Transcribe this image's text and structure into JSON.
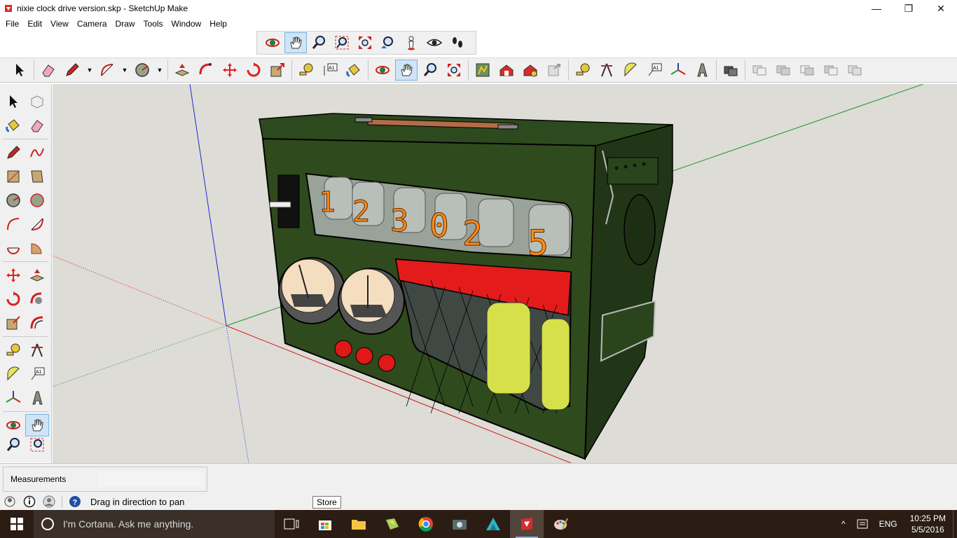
{
  "window": {
    "title": "nixie clock drive version.skp - SketchUp Make",
    "minimize": "—",
    "maximize": "❐",
    "close": "✕"
  },
  "menu": [
    "File",
    "Edit",
    "View",
    "Camera",
    "Draw",
    "Tools",
    "Window",
    "Help"
  ],
  "model": {
    "nixie_digits": [
      "1",
      "2",
      "3",
      "0",
      "2",
      "5"
    ]
  },
  "measurements": {
    "label": "Measurements",
    "value": ""
  },
  "status": {
    "hint": "Drag in direction to pan",
    "tooltip": "Store"
  },
  "taskbar": {
    "cortana_placeholder": "I'm Cortana. Ask me anything.",
    "language": "ENG",
    "time": "10:25 PM",
    "date": "5/5/2016"
  },
  "colors": {
    "viewport_bg": "#dedcd6",
    "case_green": "#2f4a1d",
    "accent_red": "#e31b1b",
    "taskbar_bg": "#2b1d14"
  }
}
